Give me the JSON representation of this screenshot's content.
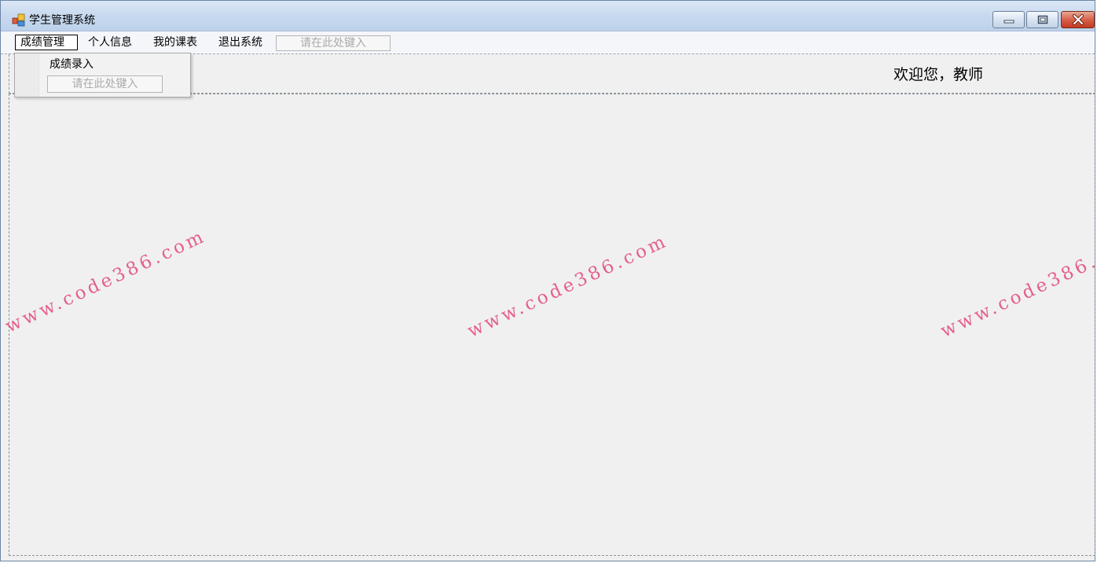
{
  "window": {
    "title": "学生管理系统"
  },
  "menubar": {
    "items": [
      {
        "label": "成绩管理"
      },
      {
        "label": "个人信息"
      },
      {
        "label": "我的课表"
      },
      {
        "label": "退出系统"
      }
    ],
    "input_placeholder": "请在此处键入"
  },
  "dropdown": {
    "items": [
      {
        "label": "成绩录入"
      }
    ],
    "input_placeholder": "请在此处键入"
  },
  "header": {
    "welcome": "欢迎您，教师"
  },
  "watermark": {
    "text": "www.code386.com",
    "color": "#e4608a"
  },
  "colors": {
    "titlebar": "#c6d8ee",
    "close_button": "#c23b22",
    "background": "#f0f0f0"
  }
}
